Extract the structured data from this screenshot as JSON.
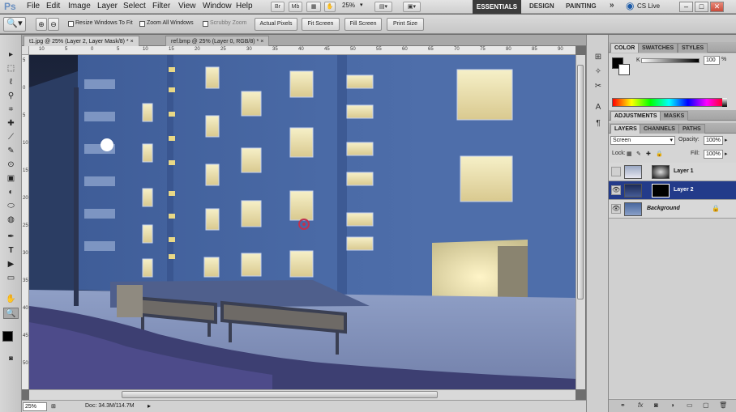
{
  "app": {
    "logo": "Ps",
    "menu": [
      "File",
      "Edit",
      "Image",
      "Layer",
      "Select",
      "Filter",
      "View",
      "Window",
      "Help"
    ],
    "header_buttons": [
      "Br",
      "Mb"
    ],
    "zoom": "25%",
    "workspaces": {
      "active": "ESSENTIALS",
      "others": [
        "DESIGN",
        "PAINTING"
      ],
      "more": "»"
    },
    "cs_live": "CS Live",
    "window_controls": [
      "–",
      "□",
      "✕"
    ]
  },
  "options": {
    "resize_windows": "Resize Windows To Fit",
    "zoom_all": "Zoom All Windows",
    "scrubby": "Scrubby Zoom",
    "buttons": [
      "Actual Pixels",
      "Fit Screen",
      "Fill Screen",
      "Print Size"
    ]
  },
  "tabs": [
    {
      "label": "t1.jpg @ 25% (Layer 2, Layer Mask/8) *",
      "close": "×"
    },
    {
      "label": "ref.bmp @ 25% (Layer 0, RGB/8) *",
      "close": "×"
    }
  ],
  "ruler": {
    "h": [
      "10",
      "5",
      "0",
      "5",
      "10",
      "15",
      "20",
      "25",
      "30",
      "35",
      "40",
      "45",
      "50",
      "55",
      "60",
      "65",
      "70",
      "75",
      "80",
      "85",
      "90"
    ],
    "v": [
      "5",
      "0",
      "5",
      "10",
      "15",
      "20",
      "25",
      "30",
      "35",
      "40",
      "45",
      "50"
    ]
  },
  "status": {
    "zoom": "25%",
    "doc": "Doc: 34.3M/114.7M"
  },
  "tools": [
    "▸",
    "⬚",
    "ℓ",
    "⚲",
    "⌗",
    "✚",
    "⟋",
    "✎",
    "⊙",
    "▣",
    "◐",
    "⬭",
    "◍",
    "✒",
    "T",
    "▶",
    "▭",
    "✋",
    "🔍"
  ],
  "dock_icons": [
    "⊞",
    "✧",
    "✂",
    "A",
    "¶"
  ],
  "color_panel": {
    "tabs": [
      "COLOR",
      "SWATCHES",
      "STYLES"
    ],
    "k_label": "K",
    "k_value": "100",
    "k_unit": "%"
  },
  "adjustments": {
    "tabs": [
      "ADJUSTMENTS",
      "MASKS"
    ]
  },
  "layers_panel": {
    "tabs": [
      "LAYERS",
      "CHANNELS",
      "PATHS"
    ],
    "blend_mode": "Screen",
    "opacity_label": "Opacity:",
    "opacity": "100%",
    "lock_label": "Lock:",
    "lock_icons": [
      "▦",
      "✎",
      "✚",
      "🔒"
    ],
    "fill_label": "Fill:",
    "fill": "100%",
    "layers": [
      {
        "name": "Layer 1",
        "visible": false,
        "selected": false
      },
      {
        "name": "Layer 2",
        "visible": true,
        "selected": true
      },
      {
        "name": "Background",
        "visible": true,
        "selected": false,
        "locked": "🔒"
      }
    ],
    "footer_icons": [
      "⚭",
      "fx",
      "◙",
      "◑",
      "▭",
      "▢",
      "🗑"
    ]
  }
}
